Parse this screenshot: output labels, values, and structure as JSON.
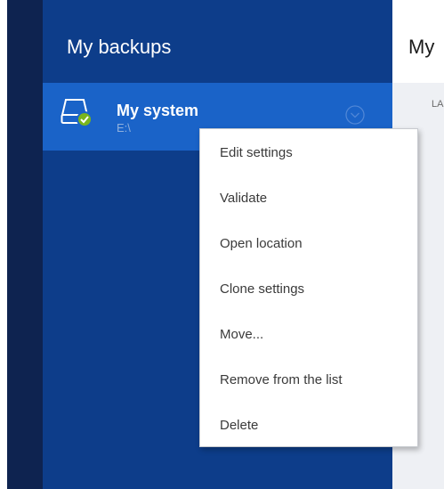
{
  "sidebar": {
    "title": "My backups",
    "items": [
      {
        "name": "My system",
        "path": "E:\\",
        "status": "ok"
      }
    ]
  },
  "right_panel": {
    "title": "My",
    "sub": "LA"
  },
  "context_menu": {
    "items": [
      "Edit settings",
      "Validate",
      "Open location",
      "Clone settings",
      "Move...",
      "Remove from the list",
      "Delete"
    ]
  },
  "colors": {
    "rail": "#0e2350",
    "panel": "#0d3d8a",
    "selected_item": "#1a63c8",
    "status_ok": "#7ab51d"
  }
}
